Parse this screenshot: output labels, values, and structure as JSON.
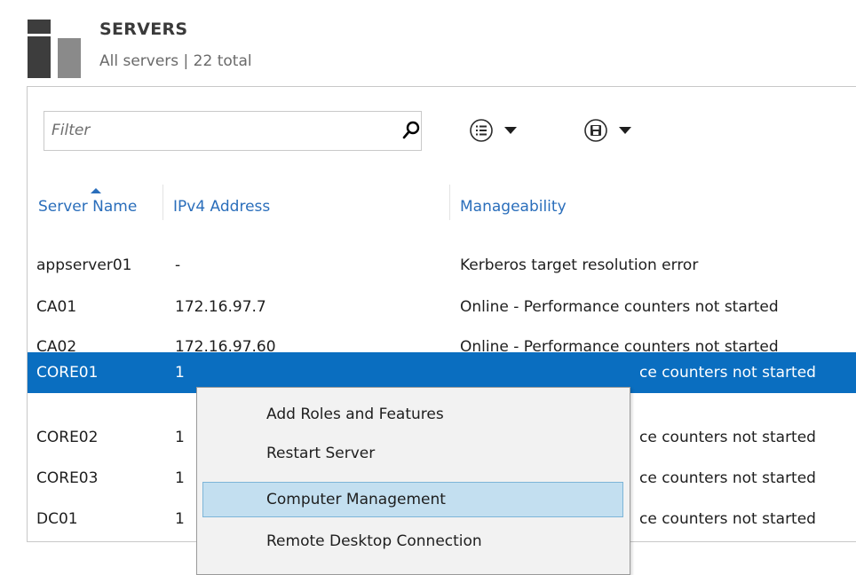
{
  "header": {
    "title": "SERVERS",
    "subtitle": "All servers | 22 total"
  },
  "toolbar": {
    "filter_placeholder": "Filter",
    "icons": [
      "search-icon",
      "list-options-icon",
      "save-icon",
      "chevron-down-icon"
    ]
  },
  "table": {
    "columns": [
      "Server Name",
      "IPv4 Address",
      "Manageability"
    ],
    "sorted_column": "Server Name",
    "rows": [
      {
        "name": "appserver01",
        "ip": "-",
        "status": "Kerberos target resolution error"
      },
      {
        "name": "CA01",
        "ip": "172.16.97.7",
        "status": "Online - Performance counters not started"
      },
      {
        "name": "CA02",
        "ip": "172.16.97.60",
        "status": "Online - Performance counters not started"
      },
      {
        "name": "CORE01",
        "ip": "1",
        "status": "ce counters not started",
        "selected": true
      },
      {
        "name": "CORE02",
        "ip": "1",
        "status": "ce counters not started"
      },
      {
        "name": "CORE03",
        "ip": "1",
        "status": "ce counters not started"
      },
      {
        "name": "DC01",
        "ip": "1",
        "status": "ce counters not started"
      }
    ]
  },
  "context_menu": {
    "items": [
      {
        "label": "Add Roles and Features"
      },
      {
        "label": "Restart Server"
      },
      {
        "label": "Computer Management",
        "highlighted": true
      },
      {
        "label": "Remote Desktop Connection"
      }
    ]
  },
  "colors": {
    "selection": "#0a6ec0",
    "link": "#2a6ebb",
    "menu_highlight": "#c3dff0"
  }
}
